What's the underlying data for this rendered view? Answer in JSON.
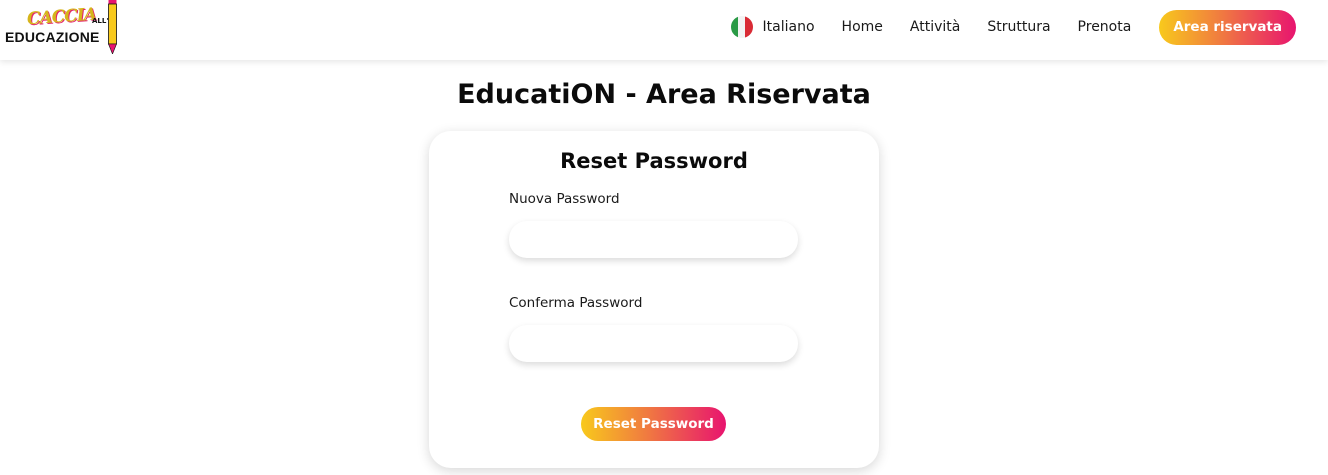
{
  "header": {
    "logo": {
      "script_text": "CACCIA",
      "small_text": "ALL'",
      "main_text": "EDUCAZIONE"
    },
    "language": {
      "label": "Italiano",
      "flag_colors": [
        "#2a9a46",
        "#f3f3f3",
        "#d92b35"
      ]
    },
    "nav": {
      "home": "Home",
      "attivita": "Attività",
      "struttura": "Struttura",
      "prenota": "Prenota"
    },
    "cta_label": "Area riservata"
  },
  "main": {
    "title": "EducatiON - Area Riservata",
    "card": {
      "title": "Reset Password",
      "new_password": {
        "label": "Nuova Password",
        "value": "",
        "placeholder": ""
      },
      "confirm_password": {
        "label": "Conferma Password",
        "value": "",
        "placeholder": ""
      },
      "submit_label": "Reset Password"
    }
  },
  "colors": {
    "gradient_start": "#f8c91c",
    "gradient_end": "#e8146f",
    "text": "#111111"
  }
}
